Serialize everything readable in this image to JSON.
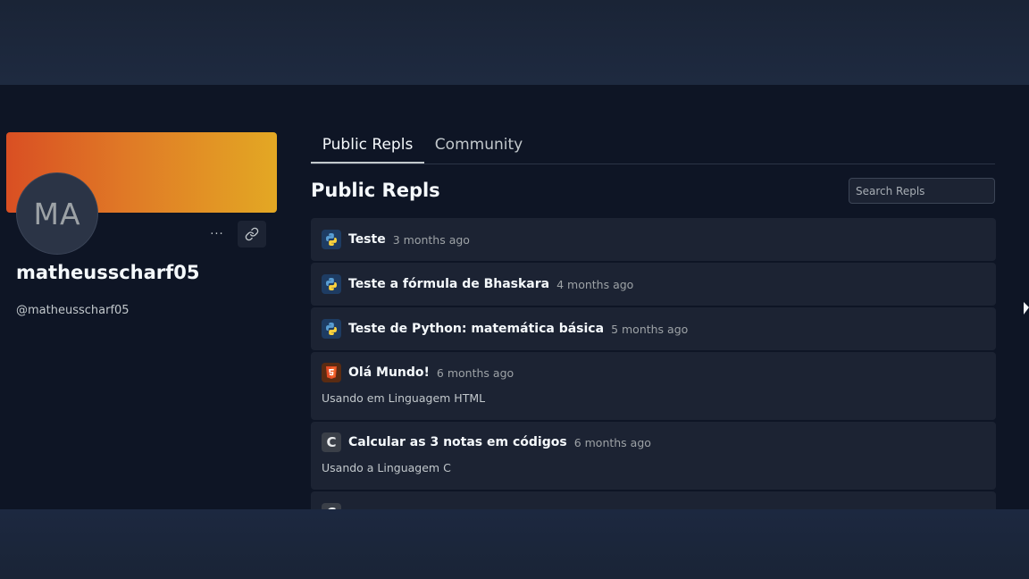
{
  "profile": {
    "avatar_initials": "MA",
    "name": "matheusscharf05",
    "handle": "@matheusscharf05",
    "more_label": "···",
    "banner_colors": [
      "#d94f23",
      "#e3a824"
    ]
  },
  "tabs": [
    {
      "label": "Public Repls",
      "active": true
    },
    {
      "label": "Community",
      "active": false
    }
  ],
  "section_title": "Public Repls",
  "search": {
    "placeholder": "Search Repls",
    "value": ""
  },
  "repls": [
    {
      "icon": "python-icon",
      "title": "Teste",
      "time": "3 months ago",
      "description": ""
    },
    {
      "icon": "python-icon",
      "title": "Teste a fórmula de Bhaskara",
      "time": "4 months ago",
      "description": ""
    },
    {
      "icon": "python-icon",
      "title": "Teste de Python: matemática básica",
      "time": "5 months ago",
      "description": ""
    },
    {
      "icon": "html5-icon",
      "title": "Olá Mundo!",
      "time": "6 months ago",
      "description": "Usando em Linguagem HTML"
    },
    {
      "icon": "c-language-icon",
      "title": "Calcular as 3 notas em códigos",
      "time": "6 months ago",
      "description": "Usando a Linguagem C"
    }
  ],
  "colors": {
    "background": "#0e1525",
    "card": "#1c2333",
    "text": "#f5f9fc",
    "muted": "#9da2a6"
  }
}
